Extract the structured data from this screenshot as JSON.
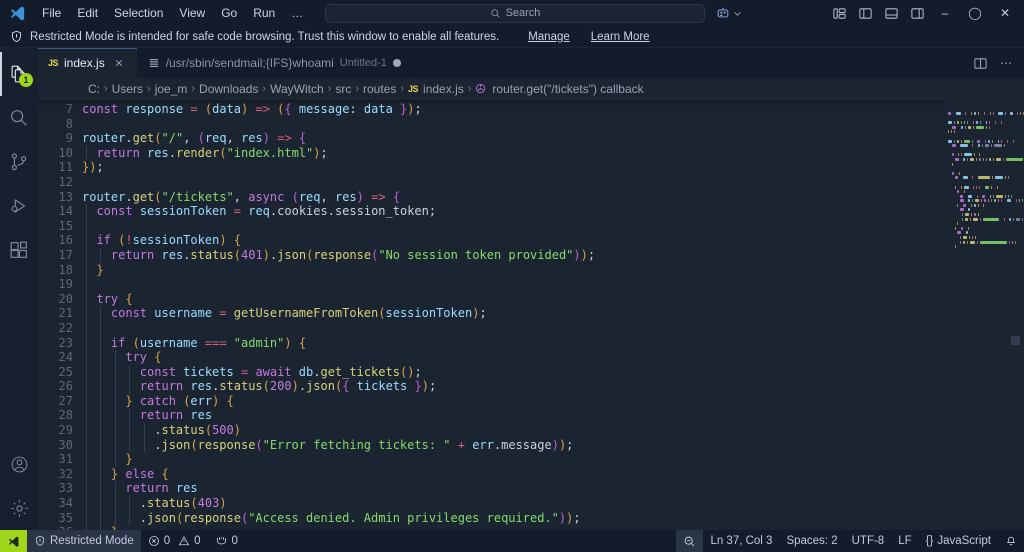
{
  "titlebar": {
    "logo_icon": "vscode-logo-icon",
    "menus": [
      "File",
      "Edit",
      "Selection",
      "View",
      "Go",
      "Run",
      "…"
    ],
    "nav_back_icon": "arrow-left-icon",
    "nav_forward_icon": "arrow-right-icon",
    "search": {
      "placeholder": "Search",
      "value": "",
      "icon": "search-icon"
    },
    "remote_icon": "remote-window-icon",
    "remote_chevron": "chevron-down-icon",
    "layout_buttons": [
      {
        "name": "toggle-panel-layout-icon"
      },
      {
        "name": "toggle-primary-sidebar-icon"
      },
      {
        "name": "toggle-panel-icon"
      },
      {
        "name": "toggle-secondary-sidebar-icon"
      }
    ],
    "window_controls": {
      "minimize": "–",
      "maximize": "◯",
      "close": "✕"
    }
  },
  "banner": {
    "icon": "shield-icon",
    "message": "Restricted Mode is intended for safe code browsing. Trust this window to enable all features.",
    "manage_link": "Manage",
    "learn_more_link": "Learn More"
  },
  "activitybar": {
    "items": [
      {
        "name": "explorer",
        "icon": "files-icon",
        "active": true,
        "badge": "1"
      },
      {
        "name": "search",
        "icon": "search-icon",
        "active": false,
        "badge": ""
      },
      {
        "name": "source-control",
        "icon": "source-control-icon",
        "active": false,
        "badge": ""
      },
      {
        "name": "run-and-debug",
        "icon": "run-debug-icon",
        "active": false,
        "badge": ""
      },
      {
        "name": "extensions",
        "icon": "extensions-icon",
        "active": false,
        "badge": ""
      }
    ],
    "bottom": [
      {
        "name": "accounts",
        "icon": "account-icon"
      },
      {
        "name": "settings",
        "icon": "gear-icon"
      }
    ]
  },
  "tabs": [
    {
      "label": "index.js",
      "icon": "js-file-icon",
      "description": "",
      "active": true,
      "dirty": false,
      "closable": true
    },
    {
      "label": "/usr/sbin/sendmail;{IFS}whoami",
      "icon": "text-file-icon",
      "description": "Untitled-1",
      "active": false,
      "dirty": true,
      "closable": false
    }
  ],
  "tabbar_actions": [
    {
      "name": "split-editor-icon"
    },
    {
      "name": "more-actions-icon",
      "glyph": "⋯"
    }
  ],
  "breadcrumb": [
    {
      "text": "C:",
      "kind": "path"
    },
    {
      "text": "Users",
      "kind": "path"
    },
    {
      "text": "joe_m",
      "kind": "path"
    },
    {
      "text": "Downloads",
      "kind": "path"
    },
    {
      "text": "WayWitch",
      "kind": "path"
    },
    {
      "text": "src",
      "kind": "path"
    },
    {
      "text": "routes",
      "kind": "path"
    },
    {
      "text": "index.js",
      "kind": "file"
    },
    {
      "text": "router.get(\"/tickets\") callback",
      "kind": "symbol"
    }
  ],
  "editor": {
    "language": "JavaScript",
    "first_line": 7,
    "lines": [
      {
        "n": 7,
        "text": "const response = (data) => ({ message: data });",
        "indent": 0
      },
      {
        "n": 8,
        "text": "",
        "indent": 0
      },
      {
        "n": 9,
        "text": "router.get(\"/\", (req, res) => {",
        "indent": 0
      },
      {
        "n": 10,
        "text": "  return res.render(\"index.html\");",
        "indent": 1
      },
      {
        "n": 11,
        "text": "});",
        "indent": 0
      },
      {
        "n": 12,
        "text": "",
        "indent": 0
      },
      {
        "n": 13,
        "text": "router.get(\"/tickets\", async (req, res) => {",
        "indent": 0
      },
      {
        "n": 14,
        "text": "  const sessionToken = req.cookies.session_token;",
        "indent": 1
      },
      {
        "n": 15,
        "text": "",
        "indent": 1
      },
      {
        "n": 16,
        "text": "  if (!sessionToken) {",
        "indent": 1
      },
      {
        "n": 17,
        "text": "    return res.status(401).json(response(\"No session token provided\"));",
        "indent": 2
      },
      {
        "n": 18,
        "text": "  }",
        "indent": 1
      },
      {
        "n": 19,
        "text": "",
        "indent": 1
      },
      {
        "n": 20,
        "text": "  try {",
        "indent": 1
      },
      {
        "n": 21,
        "text": "    const username = getUsernameFromToken(sessionToken);",
        "indent": 2
      },
      {
        "n": 22,
        "text": "",
        "indent": 2
      },
      {
        "n": 23,
        "text": "    if (username === \"admin\") {",
        "indent": 2
      },
      {
        "n": 24,
        "text": "      try {",
        "indent": 3
      },
      {
        "n": 25,
        "text": "        const tickets = await db.get_tickets();",
        "indent": 4
      },
      {
        "n": 26,
        "text": "        return res.status(200).json({ tickets });",
        "indent": 4
      },
      {
        "n": 27,
        "text": "      } catch (err) {",
        "indent": 3
      },
      {
        "n": 28,
        "text": "        return res",
        "indent": 4
      },
      {
        "n": 29,
        "text": "          .status(500)",
        "indent": 5
      },
      {
        "n": 30,
        "text": "          .json(response(\"Error fetching tickets: \" + err.message));",
        "indent": 5
      },
      {
        "n": 31,
        "text": "      }",
        "indent": 3
      },
      {
        "n": 32,
        "text": "    } else {",
        "indent": 2
      },
      {
        "n": 33,
        "text": "      return res",
        "indent": 3
      },
      {
        "n": 34,
        "text": "        .status(403)",
        "indent": 4
      },
      {
        "n": 35,
        "text": "        .json(response(\"Access denied. Admin privileges required.\"));",
        "indent": 4
      },
      {
        "n": 36,
        "text": "    }",
        "indent": 3
      }
    ]
  },
  "statusbar": {
    "remote_icon": "remote-indicator-icon",
    "restricted_mode": {
      "icon": "shield-icon",
      "label": "Restricted Mode"
    },
    "errors": {
      "icon": "error-icon",
      "count": "0"
    },
    "warnings": {
      "icon": "warning-icon",
      "count": "0"
    },
    "ports": {
      "icon": "ports-icon",
      "count": "0"
    },
    "right": {
      "zoom_icon": "zoom-out-icon",
      "cursor_position": "Ln 37, Col 3",
      "indentation": "Spaces: 2",
      "encoding": "UTF-8",
      "eol": "LF",
      "language_icon": "{}",
      "language": "JavaScript",
      "bell_icon": "bell-icon"
    }
  },
  "colors": {
    "editor_bg": "#1b2431",
    "chrome_bg": "#131c2b",
    "activitybar_bg": "#16202e",
    "accent_green": "#9fd61c",
    "string": "#87d96c",
    "keyword": "#c678dd"
  }
}
